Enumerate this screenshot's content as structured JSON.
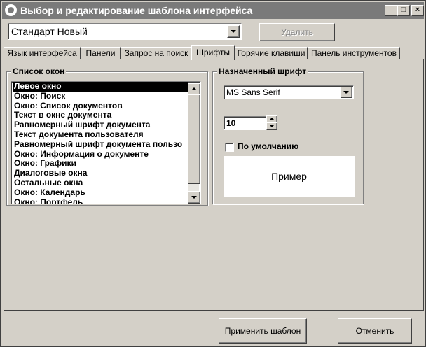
{
  "window": {
    "title": "Выбор и редактирование шаблона интерфейса",
    "minimize": "_",
    "maximize": "□",
    "close": "×"
  },
  "template": {
    "selected": "Стандарт Новый",
    "delete_label": "Удалить"
  },
  "tabs": [
    {
      "label": "Язык интерфейса"
    },
    {
      "label": "Панели"
    },
    {
      "label": "Запрос на поиск"
    },
    {
      "label": "Шрифты"
    },
    {
      "label": "Горячие клавиши"
    },
    {
      "label": "Панель инструментов"
    }
  ],
  "windows_list": {
    "legend": "Список окон",
    "items": [
      "Левое окно",
      "Окно: Поиск",
      "Окно: Список документов",
      "Текст в окне документа",
      "Равномерный шрифт документа",
      "Текст документа пользователя",
      "Равномерный шрифт документа пользо",
      "Окно: Информация о документе",
      "Окно: Графики",
      "Диалоговые окна",
      "Остальные окна",
      "Окно: Календарь",
      "Окно: Портфель"
    ]
  },
  "assigned_font": {
    "legend": "Назначенный шрифт",
    "font_name": "MS Sans Serif",
    "font_size": "10",
    "default_label": "По умолчанию",
    "sample_text": "Пример"
  },
  "footer": {
    "apply_label": "Применить шаблон",
    "cancel_label": "Отменить"
  }
}
